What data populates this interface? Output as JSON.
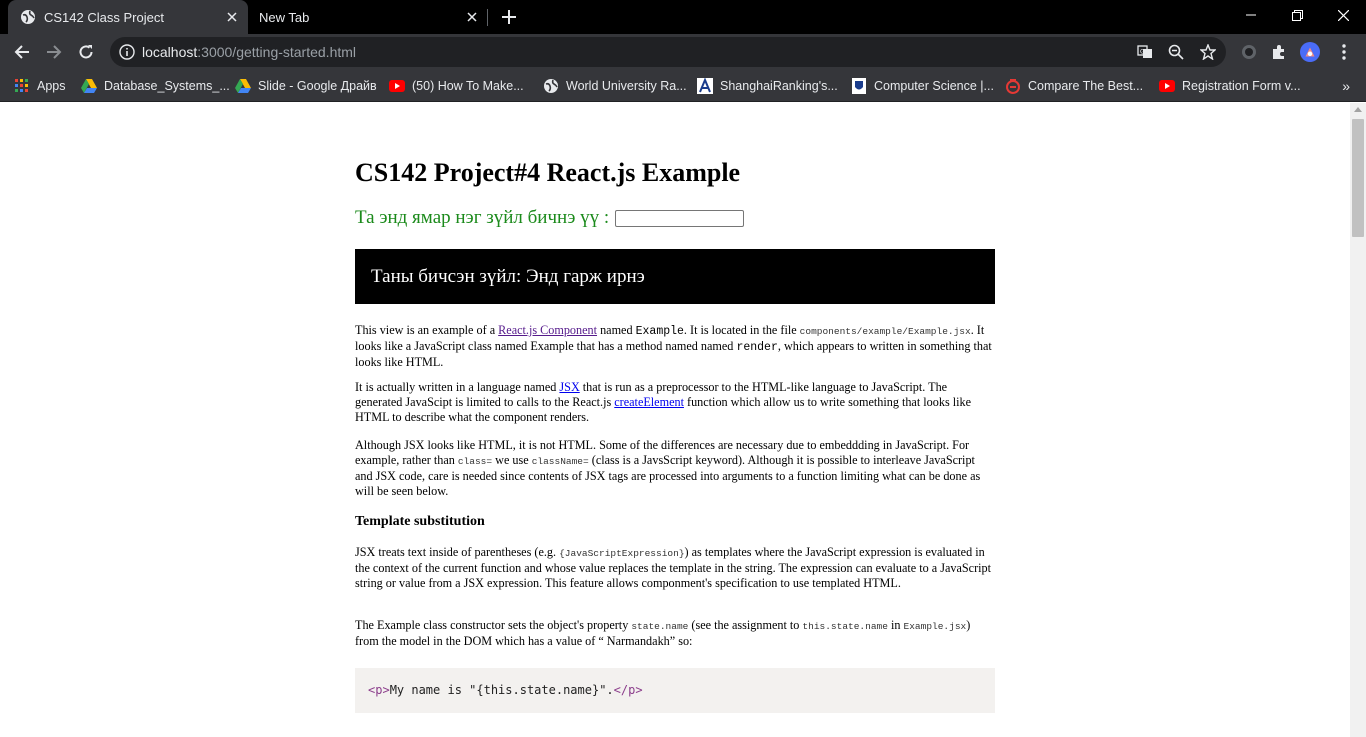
{
  "browser": {
    "tabs": [
      {
        "title": "CS142 Class Project",
        "active": true
      },
      {
        "title": "New Tab",
        "active": false
      }
    ],
    "address": {
      "host": "localhost",
      "rest": ":3000/getting-started.html"
    },
    "bookmarks": [
      {
        "label": "Apps",
        "icon": "apps-grid-icon"
      },
      {
        "label": "Database_Systems_...",
        "icon": "google-drive-icon"
      },
      {
        "label": "Slide - Google Драйв",
        "icon": "google-drive-icon"
      },
      {
        "label": "(50) How To Make...",
        "icon": "youtube-icon"
      },
      {
        "label": "World University Ra...",
        "icon": "globe-icon"
      },
      {
        "label": "ShanghaiRanking's...",
        "icon": "shanghai-ranking-icon"
      },
      {
        "label": "Computer Science |...",
        "icon": "university-icon"
      },
      {
        "label": "Compare The Best...",
        "icon": "compare-icon"
      },
      {
        "label": "Registration Form v...",
        "icon": "youtube-icon"
      }
    ],
    "colors": {
      "tab_active": "#35363a",
      "tabbar": "#000000",
      "toolbar": "#35363a",
      "omnibox": "#202124"
    }
  },
  "page": {
    "title": "CS142 Project#4 React.js Example",
    "motto_label": "Та энд ямар нэг зүйл бичнэ үү :",
    "motto_value": "",
    "output": "Таны бичсэн зүйл: Энд гарж ирнэ",
    "p1": {
      "t1": "This view is an example of a ",
      "link": "React.js Component",
      "t2": " named ",
      "code1": "Example",
      "t3": ". It is located in the file ",
      "code2": "components/example/Example.jsx",
      "t4": ". It looks like a JavaScript class named Example that has a method named named ",
      "code3": "render",
      "t5": ", which appears to written in something that looks like HTML."
    },
    "p2": {
      "t1": "It is actually written in a language named ",
      "link1": "JSX",
      "t2": " that is run as a preprocessor to the HTML-like language to JavaScript. The generated JavaScipt is limited to calls to the React.js ",
      "link2": "createElement",
      "t3": " function which allow us to write something that looks like HTML to describe what the component renders."
    },
    "p3": {
      "t1": "Although JSX looks like HTML, it is not HTML. Some of the differences are necessary due to embeddding in JavaScript. For example, rather than ",
      "code1": "class=",
      "t2": " we use ",
      "code2": "className=",
      "t3": " (class is a JavsScript keyword). Although it is possible to interleave JavaScript and JSX code, care is needed since contents of JSX tags are processed into arguments to a function limiting what can be done as will be seen below."
    },
    "h_template": "Template substitution",
    "p4": {
      "t1": "JSX treats text inside of parentheses (e.g. ",
      "code1": "{JavaScriptExpression}",
      "t2": ") as templates where the JavaScript expression is evaluated in the context of the current function and whose value replaces the template in the string. The expression can evaluate to a JavaScript string or value from a JSX expression. This feature allows componment's specification to use templated HTML."
    },
    "p5": {
      "t1": "The Example class constructor sets the object's property ",
      "code1": "state.name",
      "t2": " (see the assignment to ",
      "code2": "this.state.name",
      "t3": " in ",
      "code3": "Example.jsx",
      "t4": ") from the model in the DOM which has a value of “ Narmandakh” so:"
    },
    "code": {
      "open": "<p>",
      "body": "My name is \"{this.state.name}\".",
      "close": "</p>"
    }
  }
}
